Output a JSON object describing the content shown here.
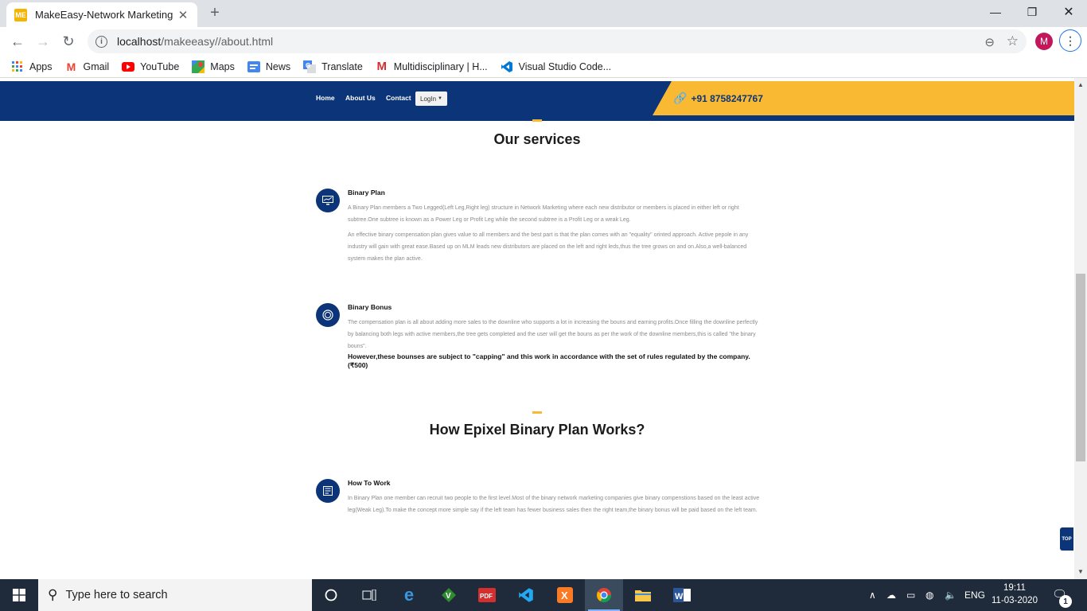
{
  "browser": {
    "tab_title": "MakeEasy-Network Marketing",
    "favicon_text": "ME",
    "url_host": "localhost",
    "url_path": "/makeeasy//about.html",
    "profile_initial": "M",
    "bookmarks": [
      {
        "label": "Apps",
        "icon": "apps-grid-icon"
      },
      {
        "label": "Gmail",
        "icon": "gmail-icon"
      },
      {
        "label": "YouTube",
        "icon": "youtube-icon"
      },
      {
        "label": "Maps",
        "icon": "maps-icon"
      },
      {
        "label": "News",
        "icon": "news-icon"
      },
      {
        "label": "Translate",
        "icon": "translate-icon"
      },
      {
        "label": "Multidisciplinary | H...",
        "icon": "m-logo-icon"
      },
      {
        "label": "Visual Studio Code...",
        "icon": "vscode-icon"
      }
    ]
  },
  "site_nav": {
    "home": "Home",
    "about": "About Us",
    "contact": "Contact",
    "login": "LogIn",
    "phone": "+91 8758247767"
  },
  "services_section": {
    "title": "Our services",
    "items": [
      {
        "title": "Binary Plan",
        "paragraphs": [
          "A Binary Plan members a Two Legged(Left Leg,Right leg) structure in Network Marketing where each new distributor or members is placed in either left or right subtree.One subtree is known as a Power Leg or Profit Leg while the second subtree is a Profit Leg or a weak Leg.",
          "An effective binary compensation plan gives value to all members and the best part is that the plan comes with an \"equality\" orinted approach. Active pepole in any industry will gain with great ease.Based up on MLM leads new distributors are placed on the left and right leds,thus the tree grows on and on.Also,a well-balanced system makes the plan active."
        ]
      },
      {
        "title": "Binary Bonus",
        "paragraphs": [
          "The compensation plan is all about adding more sales to the downline who supports a lot in increasing the bouns and earning profits.Once filling the downline perfectly by balancing both legs with active members,the tree gets completed and the user will get the bouns as per the work of the downline members,this is called \"the binary bouns\"."
        ],
        "emphasis": "However,these bounses are subject to \"capping\" and this work in accordance with the set of rules regulated by the company.(₹500)"
      }
    ]
  },
  "how_section": {
    "title": "How Epixel Binary Plan Works?",
    "items": [
      {
        "title": "How To Work",
        "paragraphs": [
          "In Binary Plan one member can recruit two people to the first level.Most of the binary network marketing companies give binary compenstions based on the least active leg(Weak Leg).To make the concept more simple say if the left team has fewer business sales then the right team,the binary bonus will be paid based on the left team."
        ]
      }
    ]
  },
  "top_button": "TOP",
  "taskbar": {
    "search_placeholder": "Type here to search",
    "language": "ENG",
    "time": "19:11",
    "date": "11-03-2020",
    "notification_count": "1"
  },
  "colors": {
    "nav_bg": "#0b3578",
    "accent": "#f9b933"
  }
}
